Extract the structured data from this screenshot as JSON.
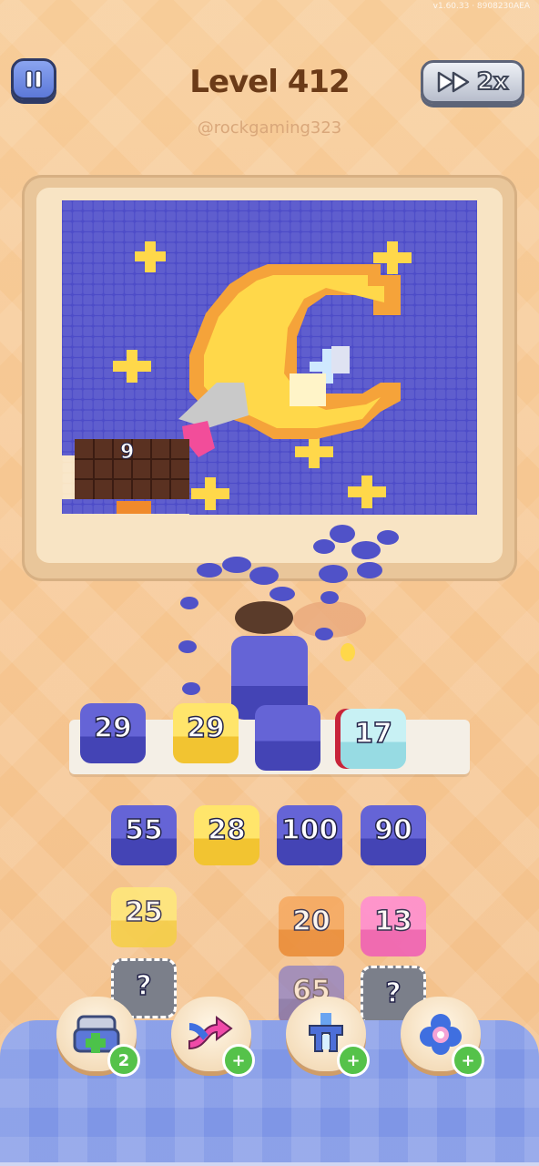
{
  "status_text": "v1.60.33 · 8908230AEA",
  "header": {
    "level_label": "Level 412",
    "watermark": "@rockgaming323",
    "speed_label": "2x"
  },
  "board": {
    "block_count": "9"
  },
  "dock": [
    {
      "value": "29",
      "color": "blue"
    },
    {
      "value": "29",
      "color": "yellow"
    },
    {
      "value": "",
      "color": "blue"
    },
    {
      "value": "17",
      "color": "cyan"
    }
  ],
  "queue": {
    "row1": [
      {
        "value": "55",
        "color": "blue"
      },
      {
        "value": "28",
        "color": "yellow"
      },
      {
        "value": "100",
        "color": "blue"
      },
      {
        "value": "90",
        "color": "blue"
      }
    ],
    "row2": [
      {
        "value": "25",
        "color": "yellow"
      },
      {
        "value": "",
        "color": "none"
      },
      {
        "value": "20",
        "color": "orange"
      },
      {
        "value": "13",
        "color": "pink"
      }
    ],
    "row3": [
      {
        "value": "?",
        "color": "mystery"
      },
      {
        "value": "",
        "color": "none"
      },
      {
        "value": "65",
        "color": "blue"
      },
      {
        "value": "?",
        "color": "mystery"
      }
    ]
  },
  "boosters": [
    {
      "name": "add-slot",
      "count": "2"
    },
    {
      "name": "shuffle",
      "count": "+"
    },
    {
      "name": "magnet",
      "count": "+"
    },
    {
      "name": "helper",
      "count": "+"
    }
  ],
  "colors": {
    "board_blue": "#4d4cc8",
    "moon_yellow": "#ffd84a",
    "moon_orange": "#f5a33a",
    "chocolate": "#5a3121"
  }
}
